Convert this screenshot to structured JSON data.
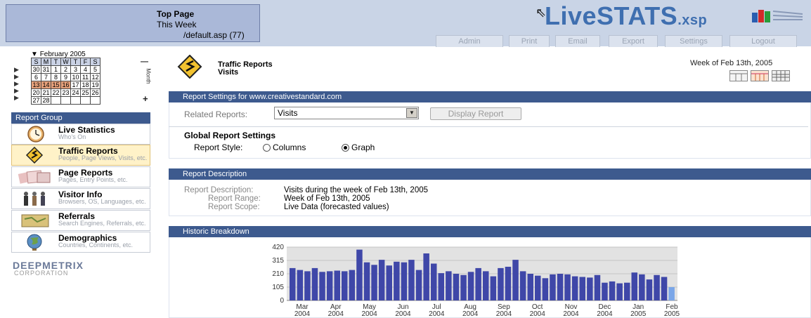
{
  "header": {
    "page_title": "Top Page",
    "period": "This Week",
    "page_path": "/default.asp (77)",
    "logo_main": "LiveSTATS",
    "logo_ext": ".xsp",
    "nav": [
      "Admin",
      "Print",
      "Email",
      "Export",
      "Settings",
      "Logout"
    ]
  },
  "calendar": {
    "month": "February 2005",
    "days_header": [
      "S",
      "M",
      "T",
      "W",
      "T",
      "F",
      "S"
    ],
    "weeks": [
      [
        "30",
        "31",
        "1",
        "2",
        "3",
        "4",
        "5"
      ],
      [
        "6",
        "7",
        "8",
        "9",
        "10",
        "11",
        "12"
      ],
      [
        "13",
        "14",
        "15",
        "16",
        "17",
        "18",
        "19"
      ],
      [
        "20",
        "21",
        "22",
        "23",
        "24",
        "25",
        "26"
      ],
      [
        "27",
        "28",
        "",
        "",
        "",
        "",
        ""
      ]
    ],
    "minus": "—",
    "plus": "+",
    "vertical_label": "Month"
  },
  "sidebar": {
    "group_title": "Report Group",
    "items": [
      {
        "title": "Live Statistics",
        "sub": "Who's On",
        "icon": "clock-icon"
      },
      {
        "title": "Traffic Reports",
        "sub": "People, Page Views, Visits, etc.",
        "icon": "traffic-sign-icon"
      },
      {
        "title": "Page Reports",
        "sub": "Pages, Entry Points, etc.",
        "icon": "pages-icon"
      },
      {
        "title": "Visitor Info",
        "sub": "Browsers, OS, Languages, etc.",
        "icon": "people-icon"
      },
      {
        "title": "Referrals",
        "sub": "Search Engines, Referrals, etc.",
        "icon": "map-icon"
      },
      {
        "title": "Demographics",
        "sub": "Countries, Continents, etc.",
        "icon": "globe-icon"
      }
    ],
    "brand": "DEEPMETRIX",
    "brand_sub": "CORPORATION"
  },
  "report": {
    "title": "Traffic Reports",
    "subtitle": "Visits",
    "week": "Week of Feb 13th, 2005"
  },
  "settings": {
    "bar_title": "Report Settings for www.creativestandard.com",
    "related_label": "Related Reports:",
    "related_value": "Visits",
    "display_button": "Display Report",
    "global_heading": "Global Report Settings",
    "style_label": "Report Style:",
    "options": [
      "Columns",
      "Graph"
    ],
    "selected": "Graph"
  },
  "description": {
    "bar_title": "Report Description",
    "desc_label": "Report Description:",
    "desc_value": "Visits during the week of Feb 13th, 2005",
    "range_label": "Report Range:",
    "range_value": "Week of Feb 13th, 2005",
    "scope_label": "Report Scope:",
    "scope_value": "Live Data (forecasted values)"
  },
  "historic": {
    "bar_title": "Historic Breakdown"
  },
  "colors": {
    "accent": "#3d5a8e",
    "bar": "#3f47a8",
    "bar_current": "#7aa6e8"
  },
  "chart_data": {
    "type": "bar",
    "title": "",
    "xlabel": "",
    "ylabel": "",
    "ylim": [
      0,
      420
    ],
    "yticks": [
      0,
      105,
      210,
      315,
      420
    ],
    "xtick_labels": [
      [
        "Mar",
        "2004"
      ],
      [
        "Apr",
        "2004"
      ],
      [
        "May",
        "2004"
      ],
      [
        "Jun",
        "2004"
      ],
      [
        "Jul",
        "2004"
      ],
      [
        "Aug",
        "2004"
      ],
      [
        "Sep",
        "2004"
      ],
      [
        "Oct",
        "2004"
      ],
      [
        "Nov",
        "2004"
      ],
      [
        "Dec",
        "2004"
      ],
      [
        "Jan",
        "2005"
      ],
      [
        "Feb",
        "2005"
      ]
    ],
    "values": [
      255,
      240,
      230,
      255,
      225,
      230,
      235,
      230,
      240,
      400,
      300,
      280,
      320,
      275,
      305,
      300,
      320,
      240,
      370,
      290,
      215,
      230,
      210,
      200,
      225,
      255,
      230,
      190,
      255,
      265,
      320,
      230,
      210,
      195,
      175,
      205,
      210,
      205,
      190,
      185,
      180,
      200,
      140,
      150,
      135,
      140,
      220,
      205,
      165,
      200,
      185,
      105
    ]
  }
}
